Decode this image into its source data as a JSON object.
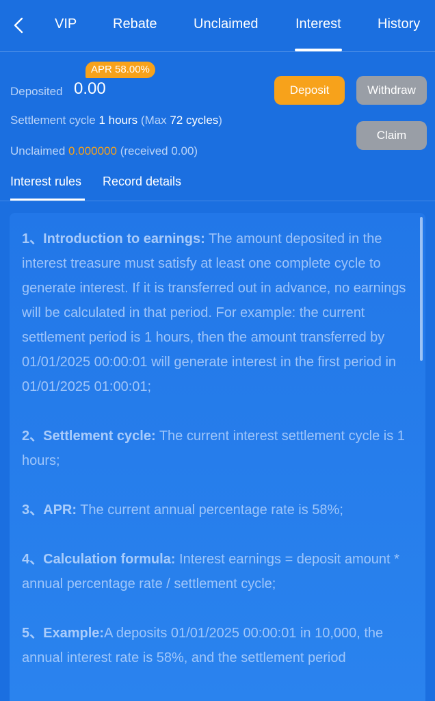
{
  "nav": {
    "tabs": [
      "VIP",
      "Rebate",
      "Unclaimed",
      "Interest",
      "History"
    ],
    "active": "Interest"
  },
  "summary": {
    "apr_badge": "APR 58.00%",
    "deposited_label": "Deposited",
    "deposited_value": "0.00",
    "cycle_label": "Settlement cycle",
    "cycle_value": "1 hours",
    "cycle_max_prefix": "(Max",
    "cycle_max_value": "72 cycles",
    "cycle_max_suffix": ")",
    "unclaimed_label": "Unclaimed",
    "unclaimed_value": "0.000000",
    "received_text": "(received 0.00)"
  },
  "buttons": {
    "deposit": "Deposit",
    "withdraw": "Withdraw",
    "claim": "Claim"
  },
  "subtabs": [
    "Interest rules",
    "Record details"
  ],
  "rules": [
    {
      "title": "1、Introduction to earnings:",
      "text": " The amount deposited in the interest treasure must satisfy at least one complete cycle to generate interest. If it is transferred out in advance, no earnings will be calculated in that period. For example: the current settlement period is 1 hours, then the amount transferred by 01/01/2025 00:00:01 will generate interest in the first period in 01/01/2025 01:00:01;"
    },
    {
      "title": "2、Settlement cycle:",
      "text": " The current interest settlement cycle is 1 hours;"
    },
    {
      "title": "3、APR:",
      "text": " The current annual percentage rate is 58%;"
    },
    {
      "title": "4、Calculation formula:",
      "text": " Interest earnings = deposit amount * annual percentage rate / settlement cycle;"
    },
    {
      "title": "5、Example:",
      "text": "A deposits 01/01/2025 00:00:01 in 10,000, the annual interest rate is 58%, and the settlement period"
    }
  ],
  "colors": {
    "background": "#1b6fe0",
    "accent": "#f7a21b",
    "disabled_button": "#999ea6"
  }
}
